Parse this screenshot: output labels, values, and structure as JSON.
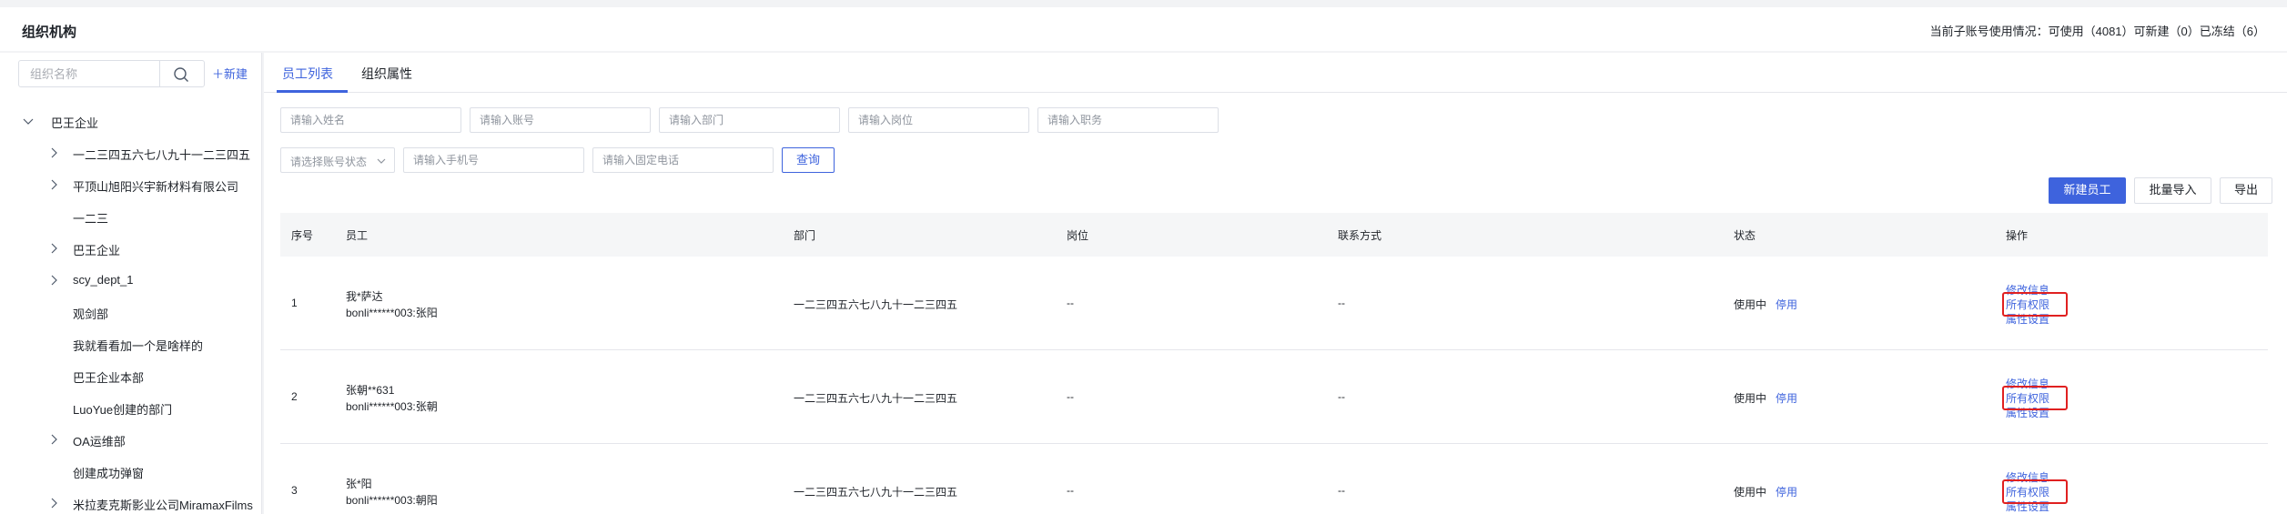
{
  "header": {
    "title": "组织机构",
    "usage": "当前子账号使用情况：可使用（4081）可新建（0）已冻结（6）"
  },
  "sidebar": {
    "search_placeholder": "组织名称",
    "new_label": "新建",
    "tree": [
      {
        "label": "巴王企业",
        "expanded": true,
        "has_children": true
      },
      {
        "label": "一二三四五六七八九十一二三四五",
        "has_children": true
      },
      {
        "label": "平顶山旭阳兴宇新材料有限公司",
        "has_children": true
      },
      {
        "label": "一二三",
        "has_children": false
      },
      {
        "label": "巴王企业",
        "has_children": true
      },
      {
        "label": "scy_dept_1",
        "has_children": true
      },
      {
        "label": "观剑部",
        "has_children": false
      },
      {
        "label": "我就看看加一个是啥样的",
        "has_children": false
      },
      {
        "label": "巴王企业本部",
        "has_children": false
      },
      {
        "label": "LuoYue创建的部门",
        "has_children": false
      },
      {
        "label": "OA运维部",
        "has_children": true
      },
      {
        "label": "创建成功弹窗",
        "has_children": false
      },
      {
        "label": "米拉麦克斯影业公司MiramaxFilms",
        "has_children": true
      }
    ]
  },
  "tabs": [
    {
      "label": "员工列表",
      "active": true
    },
    {
      "label": "组织属性",
      "active": false
    }
  ],
  "filters": {
    "name_placeholder": "请输入姓名",
    "account_placeholder": "请输入账号",
    "dept_placeholder": "请输入部门",
    "post_placeholder": "请输入岗位",
    "duty_placeholder": "请输入职务",
    "status_select": "请选择账号状态",
    "phone_placeholder": "请输入手机号",
    "tel_placeholder": "请输入固定电话",
    "query_label": "查询"
  },
  "actions": {
    "new_employee": "新建员工",
    "batch_import": "批量导入",
    "export": "导出"
  },
  "table": {
    "columns": [
      "序号",
      "员工",
      "部门",
      "岗位",
      "联系方式",
      "状态",
      "操作"
    ],
    "rows": [
      {
        "index": "1",
        "name": "我*萨达",
        "account": "bonli******003:张阳",
        "dept": "一二三四五六七八九十一二三四五",
        "post": "--",
        "contact": "--",
        "status": "使用中",
        "status_action": "停用",
        "ops": [
          "修改信息",
          "所有权限",
          "属性设置"
        ]
      },
      {
        "index": "2",
        "name": "张朝**631",
        "account": "bonli******003:张朝",
        "dept": "一二三四五六七八九十一二三四五",
        "post": "--",
        "contact": "--",
        "status": "使用中",
        "status_action": "停用",
        "ops": [
          "修改信息",
          "所有权限",
          "属性设置"
        ]
      },
      {
        "index": "3",
        "name": "张*阳",
        "account": "bonli******003:朝阳",
        "dept": "一二三四五六七八九十一二三四五",
        "post": "--",
        "contact": "--",
        "status": "使用中",
        "status_action": "停用",
        "ops": [
          "修改信息",
          "所有权限",
          "属性设置"
        ]
      }
    ]
  },
  "colors": {
    "accent": "#3e63dd",
    "highlight": "#e02020"
  }
}
